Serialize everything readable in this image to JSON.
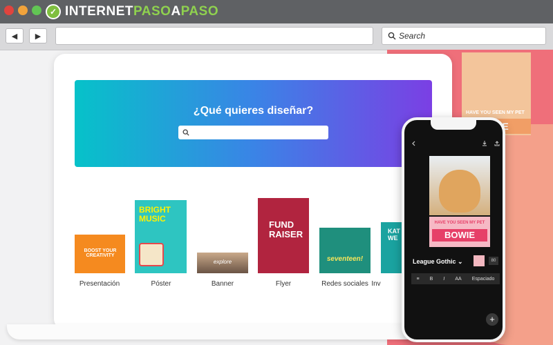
{
  "browser": {
    "logo": {
      "part1": "INTERNET",
      "part2": "PASO",
      "part3": "A",
      "part4": "PASO"
    },
    "search_label": "Search",
    "back_glyph": "◀",
    "forward_glyph": "▶",
    "window_buttons": {
      "close": "#e0443e",
      "minimize": "#f1a33b",
      "maximize": "#62c554"
    }
  },
  "hero": {
    "title": "¿Qué quieres diseñar?",
    "search_icon": "search-icon"
  },
  "templates": [
    {
      "label": "Presentación",
      "art": "BOOST YOUR CREATIVITY"
    },
    {
      "label": "Póster",
      "art": "BRIGHT MUSIC"
    },
    {
      "label": "Banner",
      "art": "explore"
    },
    {
      "label": "Flyer",
      "art": "FUND RAISER"
    },
    {
      "label": "Redes sociales",
      "art": "seventeen!"
    },
    {
      "label": "Inv",
      "art": "KAT WE"
    }
  ],
  "phone": {
    "tag_title": "HAVE YOU SEEN MY PET",
    "tag_name": "BOWIE",
    "font_name": "League Gothic",
    "font_size": "80",
    "toolbar": [
      "B",
      "I",
      "AA",
      "Espaciado"
    ],
    "fab": "+"
  },
  "background_poster": {
    "title": "HAVE YOU SEEN MY PET",
    "name": "BIE"
  }
}
